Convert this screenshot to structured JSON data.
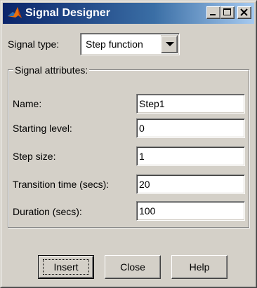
{
  "window": {
    "title": "Signal Designer",
    "icon": "matlab-icon",
    "controls": [
      "minimize-icon",
      "maximize-icon",
      "close-icon"
    ]
  },
  "signal_type": {
    "label": "Signal type:",
    "value": "Step function",
    "icon": "chevron-down-icon"
  },
  "attributes": {
    "title": "Signal attributes:",
    "fields": [
      {
        "label": "Name:",
        "value": "Step1"
      },
      {
        "label": "Starting level:",
        "value": "0"
      },
      {
        "label": "Step size:",
        "value": "1"
      },
      {
        "label": "Transition time (secs):",
        "value": "20"
      },
      {
        "label": "Duration (secs):",
        "value": "100"
      }
    ]
  },
  "buttons": {
    "insert": "Insert",
    "close": "Close",
    "help": "Help"
  },
  "colors": {
    "face": "#d4d0c8",
    "title_start": "#0a246a",
    "title_end": "#a6caf0"
  }
}
